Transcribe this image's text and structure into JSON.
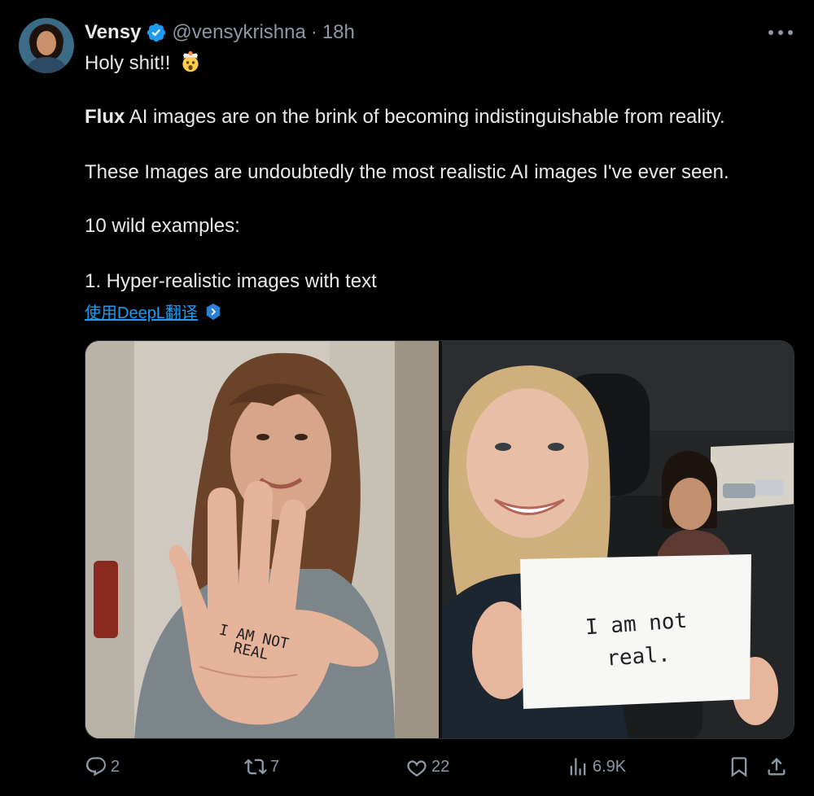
{
  "author": {
    "name": "Vensy",
    "handle": "@vensykrishna",
    "separator": "·",
    "time": "18h",
    "verified": true,
    "avatar_icon": "profile-avatar"
  },
  "tweet": {
    "line1": "Holy shit!!",
    "line1_emoji": "exploding-head-emoji",
    "line2_bold": "Flux",
    "line2_rest": " AI images are on the brink of becoming indistinguishable from reality.",
    "line3": "These Images are undoubtedly the most realistic AI images I've ever seen.",
    "line4": "10 wild examples:",
    "line5": "1. Hyper-realistic images with text"
  },
  "translate_link": "使用DeepL翻译",
  "media": {
    "left_sign": "I AM NOT REAL",
    "right_sign": "I am not real."
  },
  "actions": {
    "replies": "2",
    "reposts": "7",
    "likes": "22",
    "views": "6.9K"
  },
  "colors": {
    "background": "#000000",
    "text": "#e7e9ea",
    "muted": "#8b98a5",
    "accent": "#1d9bf0"
  }
}
